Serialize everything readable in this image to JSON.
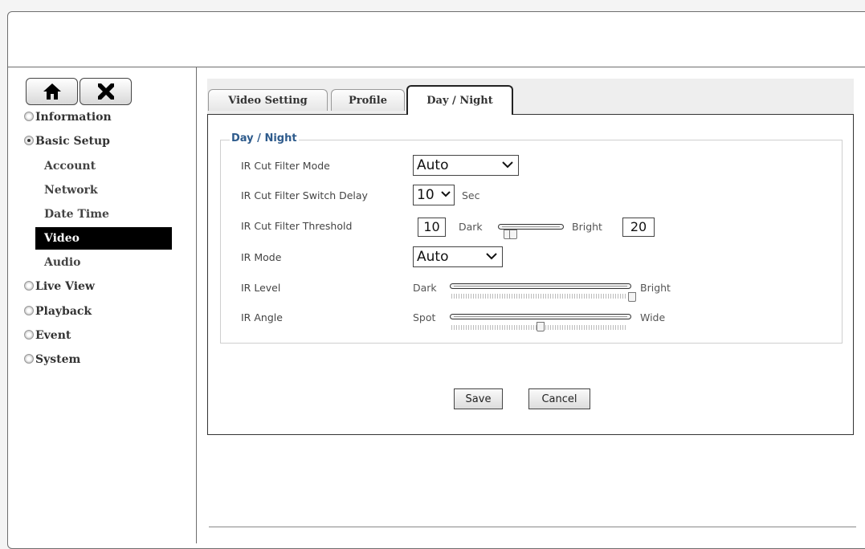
{
  "sidebar": {
    "top_icons": [
      "home-icon",
      "tools-icon"
    ],
    "items": [
      {
        "label": "Information",
        "expanded": false
      },
      {
        "label": "Basic Setup",
        "expanded": true
      },
      {
        "label": "Live View",
        "expanded": false
      },
      {
        "label": "Playback",
        "expanded": false
      },
      {
        "label": "Event",
        "expanded": false
      },
      {
        "label": "System",
        "expanded": false
      }
    ],
    "subitems": [
      {
        "label": "Account"
      },
      {
        "label": "Network"
      },
      {
        "label": "Date Time"
      },
      {
        "label": "Video",
        "active": true
      },
      {
        "label": "Audio"
      }
    ]
  },
  "tabs": [
    {
      "label": "Video Setting"
    },
    {
      "label": "Profile"
    },
    {
      "label": "Day / Night",
      "active": true
    }
  ],
  "section": {
    "legend": "Day / Night",
    "ir_cut_mode": {
      "label": "IR Cut Filter Mode",
      "value": "Auto"
    },
    "ir_cut_delay": {
      "label": "IR Cut Filter Switch Delay",
      "value": "10",
      "unit": "Sec"
    },
    "ir_cut_threshold": {
      "label": "IR Cut Filter Threshold",
      "dark_value": "10",
      "dark_label": "Dark",
      "bright_label": "Bright",
      "bright_value": "20",
      "slider_fraction_low": 0.1,
      "slider_fraction_high": 0.2
    },
    "ir_mode": {
      "label": "IR Mode",
      "value": "Auto"
    },
    "ir_level": {
      "label": "IR Level",
      "left_label": "Dark",
      "right_label": "Bright",
      "slider_fraction": 1.0
    },
    "ir_angle": {
      "label": "IR Angle",
      "left_label": "Spot",
      "right_label": "Wide",
      "slider_fraction": 0.5
    }
  },
  "buttons": {
    "save": "Save",
    "cancel": "Cancel"
  },
  "colors": {
    "legend": "#2e5b8c",
    "active_nav_bg": "#000000",
    "border": "#333333"
  }
}
